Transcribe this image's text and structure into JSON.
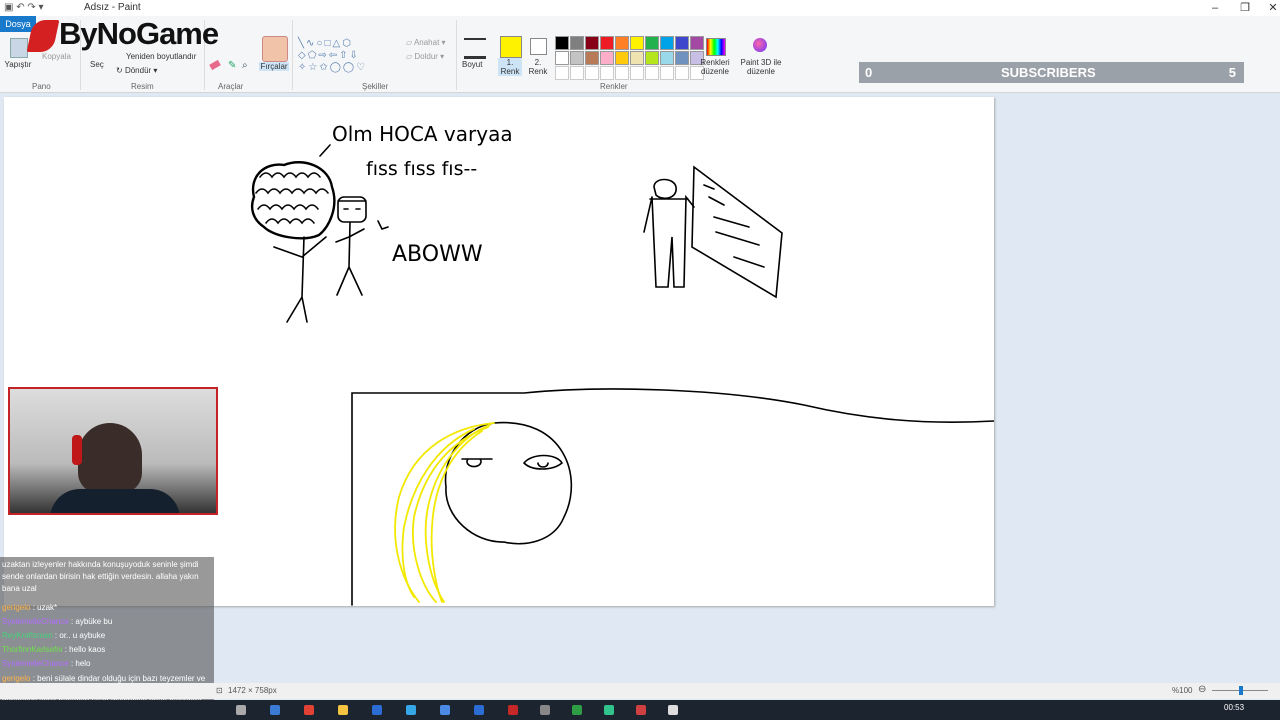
{
  "window": {
    "title": "Adsız - Paint",
    "minimize": "–",
    "maximize": "❐",
    "close": "✕"
  },
  "quick_access": "▣  ↶  ↷  ▾",
  "ribbon": {
    "file_tab": "Dosya",
    "logo_text": "ByNoGame",
    "pano": {
      "paste": "Yapıştır",
      "copy": "Kopyala",
      "label": "Pano"
    },
    "resim": {
      "select": "Seç",
      "resize": "Yeniden boyutlandır",
      "rotate": "Döndür",
      "label": "Resim"
    },
    "araclar": {
      "label": "Araçlar"
    },
    "brushes": "Fırçalar",
    "sekiller": {
      "outline": "Anahat",
      "fill": "Doldur",
      "label": "Şekiller"
    },
    "size": "Boyut",
    "color1": "1. Renk",
    "color2": "2. Renk",
    "edit_colors": "Renkleri düzenle",
    "paint3d": "Paint 3D ile düzenle",
    "renkler": {
      "label": "Renkler"
    },
    "palette_row1": [
      "#000000",
      "#7f7f7f",
      "#880015",
      "#ed1c24",
      "#ff7f27",
      "#fff200",
      "#22b14c",
      "#00a2e8",
      "#3f48cc",
      "#a349a4"
    ],
    "palette_row2": [
      "#ffffff",
      "#c3c3c3",
      "#b97a57",
      "#ffaec9",
      "#ffc90e",
      "#efe4b0",
      "#b5e61d",
      "#99d9ea",
      "#7092be",
      "#c8bfe7"
    ],
    "color1_value": "#fff200",
    "color2_value": "#ffffff"
  },
  "subscribers": {
    "left": "0",
    "label": "SUBSCRIBERS",
    "right": "5"
  },
  "canvas_text": {
    "speech1": "Olm HOCA varyaa",
    "speech2": "fıss fıss fıs--",
    "speech3": "ABOWW"
  },
  "chat": [
    {
      "user": "",
      "text": "uzaktan izleyenler hakkında konuşuyoduk seninle şimdi sende onlardan birisin hak ettiğin verdesin. allaha yakın bana uzal"
    },
    {
      "user": "gerigelo",
      "text": ": uzak*"
    },
    {
      "user": "SystemelleChance",
      "text": ": aybüke bu"
    },
    {
      "user": "ReyKraftsman",
      "text": ": or.. u aybuke"
    },
    {
      "user": "ThorfinnKarlsefni",
      "text": ": hello kaos"
    },
    {
      "user": "SystemelleChance",
      "text": ": helo"
    },
    {
      "user": "gerigelo",
      "text": ": beni sülale dindar olduğu için bazı teyzemler ve yengemler kızlarını okulunu dondurup kuran kursuna gönderiyo veya pantolon falan giydirmiyo onun hakkında konuştuk ablamla ne mallar diye"
    }
  ],
  "statusbar": {
    "size": "1472 × 758px",
    "zoom": "%100"
  },
  "taskbar": {
    "time": "00:53"
  }
}
